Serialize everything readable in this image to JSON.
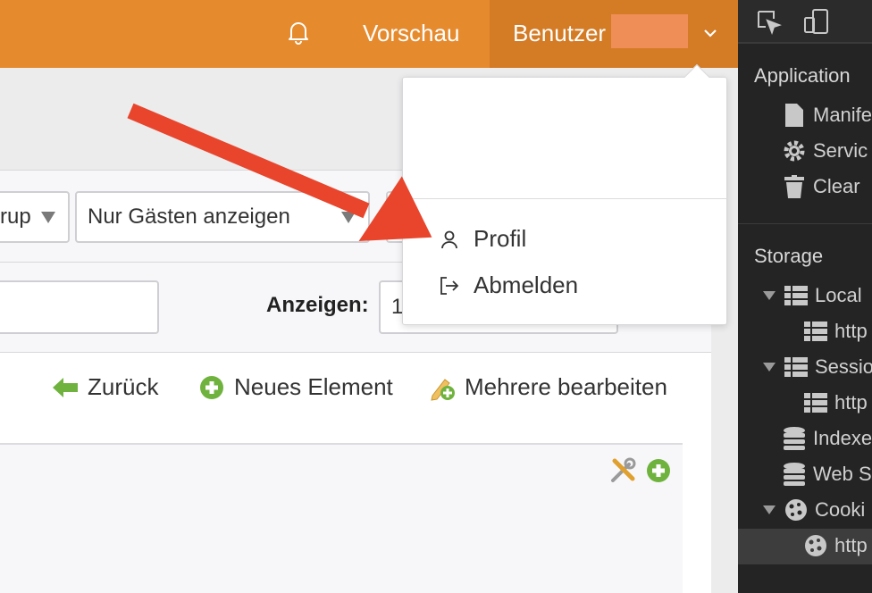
{
  "header": {
    "preview_label": "Vorschau",
    "user_label": "Benutzer"
  },
  "filters": {
    "group_select": "rup",
    "guest_select": "Nur Gästen anzeigen"
  },
  "list": {
    "show_label": "Anzeigen:",
    "show_value": "1"
  },
  "actions": {
    "back": "Zurück",
    "new_element": "Neues Element",
    "multi_edit": "Mehrere bearbeiten"
  },
  "user_menu": {
    "profile": "Profil",
    "logout": "Abmelden"
  },
  "devtools": {
    "application_heading": "Application",
    "app_items": [
      "Manife",
      "Servic",
      "Clear"
    ],
    "storage_heading": "Storage",
    "storage_items": [
      "Local",
      "http",
      "Sessio",
      "http",
      "Indexe",
      "Web S",
      "Cooki",
      "http"
    ]
  },
  "colors": {
    "topbar": "#e68a2e",
    "user_area": "#d47b25",
    "arrow": "#e8452c",
    "green_icon": "#6fb33e",
    "devtools_bg": "#242424"
  }
}
